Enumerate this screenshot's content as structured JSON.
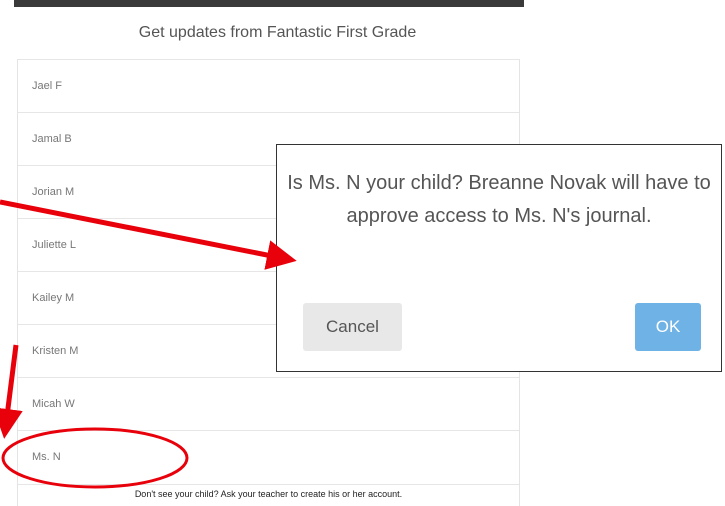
{
  "header": {
    "title": "Get updates from Fantastic First Grade"
  },
  "students": [
    {
      "name": "Jael F"
    },
    {
      "name": "Jamal B"
    },
    {
      "name": "Jorian M"
    },
    {
      "name": "Juliette L"
    },
    {
      "name": "Kailey M"
    },
    {
      "name": "Kristen M"
    },
    {
      "name": "Micah W"
    },
    {
      "name": "Ms. N"
    }
  ],
  "footer": {
    "note": "Don't see your child? Ask your teacher to create his or her account."
  },
  "dialog": {
    "message": "Is Ms. N your child? Breanne Novak will have to approve access to Ms. N's journal.",
    "cancel_label": "Cancel",
    "ok_label": "OK"
  },
  "colors": {
    "ok_button": "#6fb2e6",
    "cancel_button": "#e8e8e8",
    "annotation": "#e8000b"
  }
}
